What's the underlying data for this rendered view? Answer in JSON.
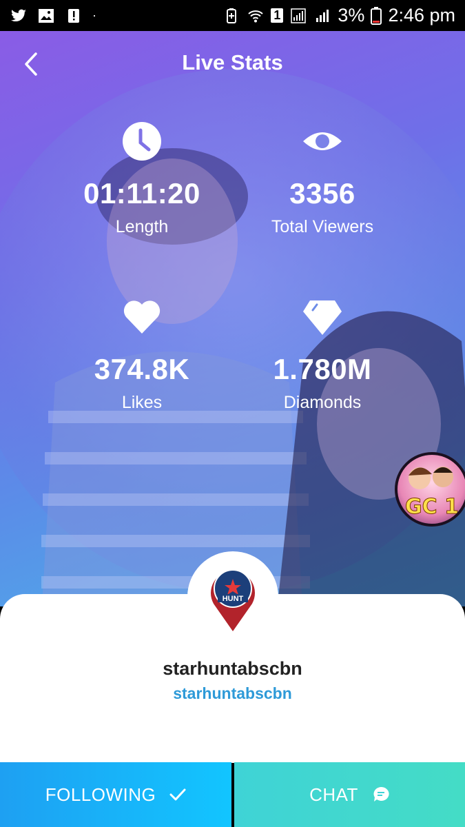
{
  "status_bar": {
    "icons_left": [
      "twitter-icon",
      "image-icon",
      "alert-icon",
      "dot"
    ],
    "icons_right": [
      "battery-saver-icon",
      "wifi-icon",
      "sim-icon",
      "signal-icon"
    ],
    "sim_badge": "1",
    "battery": "3%",
    "time": "2:46 pm"
  },
  "header": {
    "title": "Live Stats",
    "back_icon": "chevron-left-icon"
  },
  "stats": {
    "length": {
      "icon": "clock-icon",
      "value": "01:11:20",
      "label": "Length"
    },
    "viewers": {
      "icon": "eye-icon",
      "value": "3356",
      "label": "Total Viewers"
    },
    "likes": {
      "icon": "heart-icon",
      "value": "374.8K",
      "label": "Likes"
    },
    "diamonds": {
      "icon": "diamond-icon",
      "value": "1.780M",
      "label": "Diamonds"
    }
  },
  "floating_badge": {
    "text": "GC 1"
  },
  "profile": {
    "avatar_icon": "star-hunt-logo",
    "name": "starhuntabscbn",
    "handle": "starhuntabscbn"
  },
  "actions": {
    "following_label": "FOLLOWING",
    "following_icon": "check-icon",
    "chat_label": "CHAT",
    "chat_icon": "chat-bubble-icon"
  },
  "colors": {
    "accent_blue": "#2e9ad8",
    "follow_button": "#1ea0f2",
    "chat_button": "#3fd3d6"
  }
}
